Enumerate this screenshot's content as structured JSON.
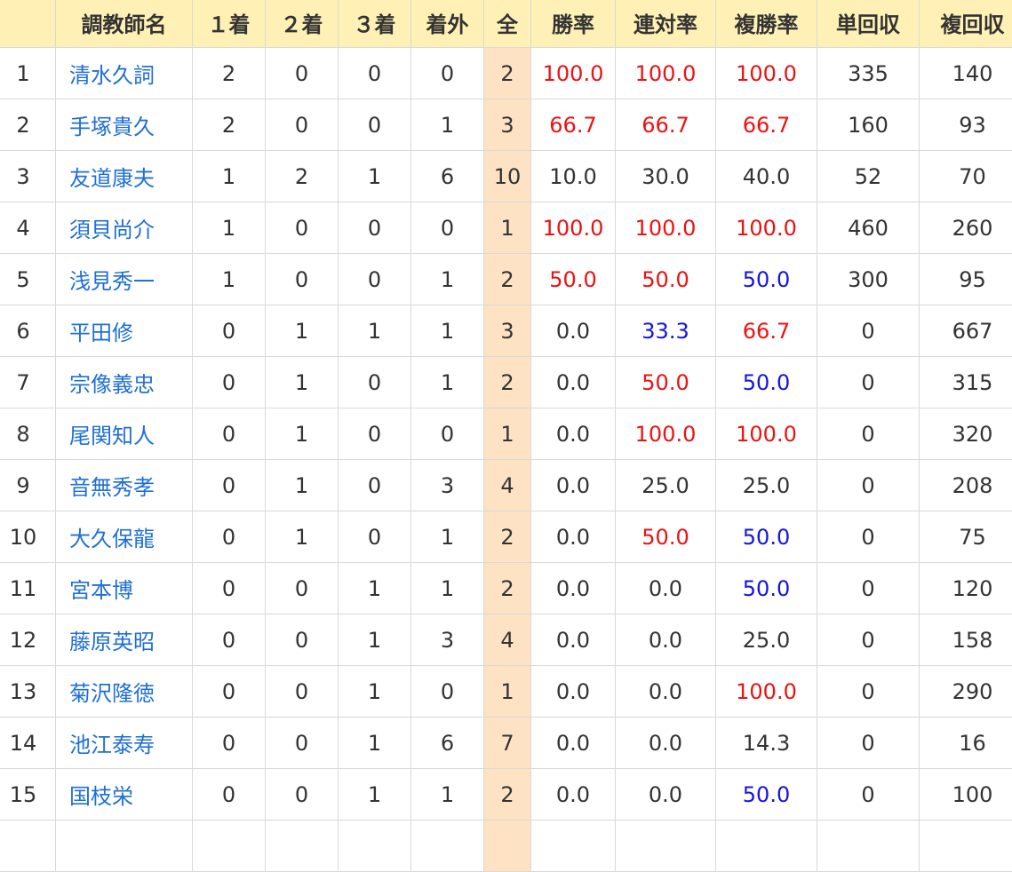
{
  "table": {
    "headers": {
      "rank": "",
      "name": "調教師名",
      "first": "１着",
      "second": "２着",
      "third": "３着",
      "other": "着外",
      "total": "全",
      "win_rate": "勝率",
      "quinella_rate": "連対率",
      "place_rate": "複勝率",
      "win_return": "単回収",
      "place_return": "複回収"
    },
    "rows": [
      {
        "rank": "1",
        "name": "清水久詞",
        "first": "2",
        "second": "0",
        "third": "0",
        "other": "0",
        "total": "2",
        "win_rate": "100.0",
        "quinella_rate": "100.0",
        "place_rate": "100.0",
        "win_return": "335",
        "place_return": "140"
      },
      {
        "rank": "2",
        "name": "手塚貴久",
        "first": "2",
        "second": "0",
        "third": "0",
        "other": "1",
        "total": "3",
        "win_rate": "66.7",
        "quinella_rate": "66.7",
        "place_rate": "66.7",
        "win_return": "160",
        "place_return": "93"
      },
      {
        "rank": "3",
        "name": "友道康夫",
        "first": "1",
        "second": "2",
        "third": "1",
        "other": "6",
        "total": "10",
        "win_rate": "10.0",
        "quinella_rate": "30.0",
        "place_rate": "40.0",
        "win_return": "52",
        "place_return": "70"
      },
      {
        "rank": "4",
        "name": "須貝尚介",
        "first": "1",
        "second": "0",
        "third": "0",
        "other": "0",
        "total": "1",
        "win_rate": "100.0",
        "quinella_rate": "100.0",
        "place_rate": "100.0",
        "win_return": "460",
        "place_return": "260"
      },
      {
        "rank": "5",
        "name": "浅見秀一",
        "first": "1",
        "second": "0",
        "third": "0",
        "other": "1",
        "total": "2",
        "win_rate": "50.0",
        "quinella_rate": "50.0",
        "place_rate": "50.0",
        "win_return": "300",
        "place_return": "95"
      },
      {
        "rank": "6",
        "name": "平田修",
        "first": "0",
        "second": "1",
        "third": "1",
        "other": "1",
        "total": "3",
        "win_rate": "0.0",
        "quinella_rate": "33.3",
        "place_rate": "66.7",
        "win_return": "0",
        "place_return": "667"
      },
      {
        "rank": "7",
        "name": "宗像義忠",
        "first": "0",
        "second": "1",
        "third": "0",
        "other": "1",
        "total": "2",
        "win_rate": "0.0",
        "quinella_rate": "50.0",
        "place_rate": "50.0",
        "win_return": "0",
        "place_return": "315"
      },
      {
        "rank": "8",
        "name": "尾関知人",
        "first": "0",
        "second": "1",
        "third": "0",
        "other": "0",
        "total": "1",
        "win_rate": "0.0",
        "quinella_rate": "100.0",
        "place_rate": "100.0",
        "win_return": "0",
        "place_return": "320"
      },
      {
        "rank": "9",
        "name": "音無秀孝",
        "first": "0",
        "second": "1",
        "third": "0",
        "other": "3",
        "total": "4",
        "win_rate": "0.0",
        "quinella_rate": "25.0",
        "place_rate": "25.0",
        "win_return": "0",
        "place_return": "208"
      },
      {
        "rank": "10",
        "name": "大久保龍",
        "first": "0",
        "second": "1",
        "third": "0",
        "other": "1",
        "total": "2",
        "win_rate": "0.0",
        "quinella_rate": "50.0",
        "place_rate": "50.0",
        "win_return": "0",
        "place_return": "75"
      },
      {
        "rank": "11",
        "name": "宮本博",
        "first": "0",
        "second": "0",
        "third": "1",
        "other": "1",
        "total": "2",
        "win_rate": "0.0",
        "quinella_rate": "0.0",
        "place_rate": "50.0",
        "win_return": "0",
        "place_return": "120"
      },
      {
        "rank": "12",
        "name": "藤原英昭",
        "first": "0",
        "second": "0",
        "third": "1",
        "other": "3",
        "total": "4",
        "win_rate": "0.0",
        "quinella_rate": "0.0",
        "place_rate": "25.0",
        "win_return": "0",
        "place_return": "158"
      },
      {
        "rank": "13",
        "name": "菊沢隆徳",
        "first": "0",
        "second": "0",
        "third": "1",
        "other": "0",
        "total": "1",
        "win_rate": "0.0",
        "quinella_rate": "0.0",
        "place_rate": "100.0",
        "win_return": "0",
        "place_return": "290"
      },
      {
        "rank": "14",
        "name": "池江泰寿",
        "first": "0",
        "second": "0",
        "third": "1",
        "other": "6",
        "total": "7",
        "win_rate": "0.0",
        "quinella_rate": "0.0",
        "place_rate": "14.3",
        "win_return": "0",
        "place_return": "16"
      },
      {
        "rank": "15",
        "name": "国枝栄",
        "first": "0",
        "second": "0",
        "third": "1",
        "other": "1",
        "total": "2",
        "win_rate": "0.0",
        "quinella_rate": "0.0",
        "place_rate": "50.0",
        "win_return": "0",
        "place_return": "100"
      },
      {
        "rank": "",
        "name": "",
        "first": "",
        "second": "",
        "third": "",
        "other": "",
        "total": "",
        "win_rate": "",
        "quinella_rate": "",
        "place_rate": "",
        "win_return": "",
        "place_return": ""
      }
    ]
  },
  "colors": {
    "header_bg": "#fff1b5",
    "total_col_bg": "#fde3c4",
    "link": "#1f6fd6",
    "high_rate": "#ee1111",
    "mid_rate": "#1414e0",
    "text": "#333333",
    "border": "#d9d9d9"
  }
}
